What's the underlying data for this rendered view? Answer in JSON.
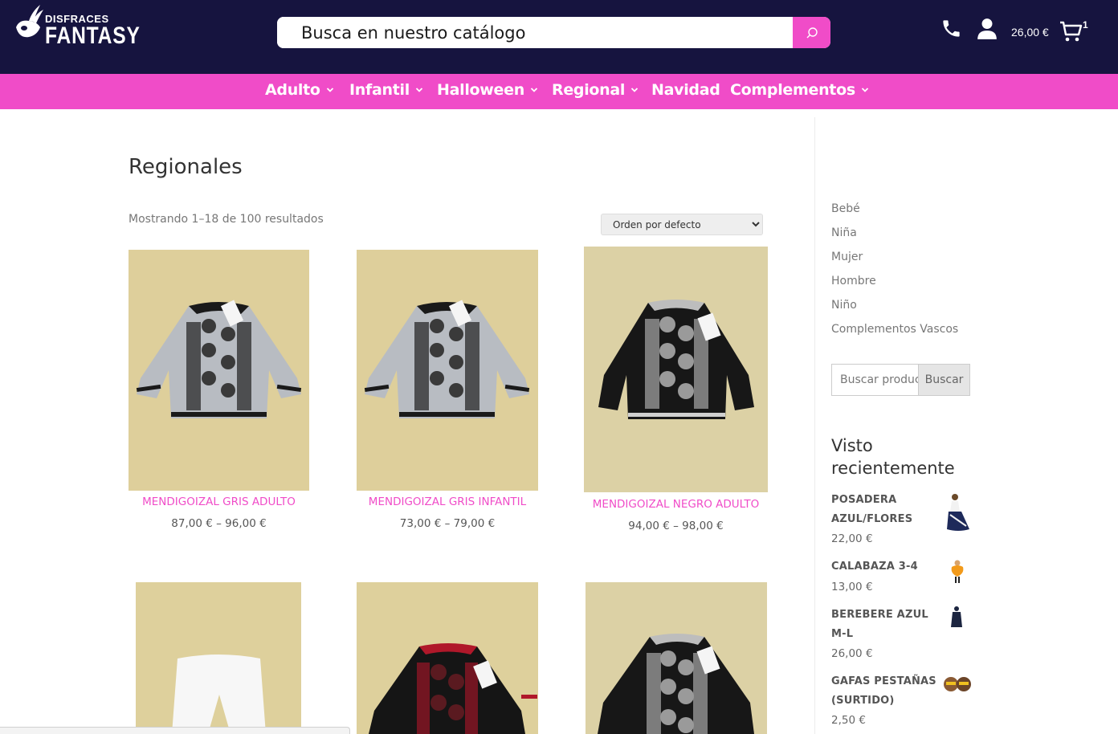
{
  "header": {
    "logo_small": "DISFRACES",
    "logo_big": "FANTASY",
    "search_placeholder": "Busca en nuestro catálogo",
    "cart_total": "26,00 €",
    "cart_count": "1"
  },
  "nav": {
    "items": [
      {
        "label": "Adulto",
        "has_dropdown": true
      },
      {
        "label": "Infantil",
        "has_dropdown": true
      },
      {
        "label": "Halloween",
        "has_dropdown": true
      },
      {
        "label": "Regional",
        "has_dropdown": true
      },
      {
        "label": "Navidad",
        "has_dropdown": false
      },
      {
        "label": "Complementos",
        "has_dropdown": true
      }
    ]
  },
  "main": {
    "title": "Regionales",
    "results_text": "Mostrando 1–18 de 100 resultados",
    "orderby_selected": "Orden por defecto",
    "products": [
      {
        "name": "MENDIGOIZAL GRIS ADULTO",
        "price": "87,00 € – 96,00 €",
        "color": "grey"
      },
      {
        "name": "MENDIGOIZAL GRIS INFANTIL",
        "price": "73,00 € – 79,00 €",
        "color": "grey"
      },
      {
        "name": "MENDIGOIZAL NEGRO ADULTO",
        "price": "94,00 € – 98,00 €",
        "color": "black"
      },
      {
        "name": "",
        "price": "",
        "color": "white-pants"
      },
      {
        "name": "",
        "price": "",
        "color": "black-red"
      },
      {
        "name": "",
        "price": "",
        "color": "black"
      }
    ]
  },
  "sidebar": {
    "categories": [
      "Bebé",
      "Niña",
      "Mujer",
      "Hombre",
      "Niño",
      "Complementos Vascos"
    ],
    "search_placeholder": "Buscar productos",
    "search_button": "Buscar",
    "recent_title": "Visto recientemente",
    "recent": [
      {
        "name": "POSADERA AZUL/FLORES",
        "price": "22,00 €"
      },
      {
        "name": "CALABAZA 3-4",
        "price": "13,00 €"
      },
      {
        "name": "BEREBERE AZUL M-L",
        "price": "26,00 €"
      },
      {
        "name": "GAFAS PESTAÑAS (SURTIDO)",
        "price": "2,50 €"
      }
    ]
  },
  "colors": {
    "header_bg": "#16143f",
    "accent": "#f04cc8"
  },
  "icons": [
    "search-icon",
    "phone-icon",
    "user-icon",
    "cart-icon",
    "chevron-down-icon"
  ]
}
